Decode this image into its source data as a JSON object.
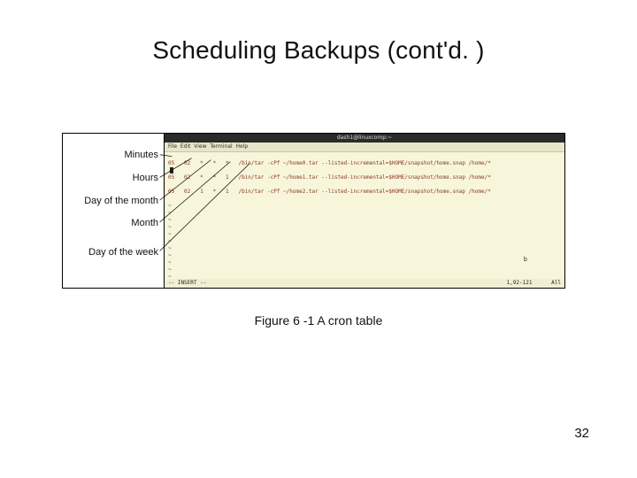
{
  "title": "Scheduling Backups (cont'd. )",
  "caption": "Figure 6 -1 A cron table",
  "page_number": "32",
  "labels": {
    "minutes": "Minutes",
    "hours": "Hours",
    "dom": "Day of the month",
    "month": "Month",
    "dow": "Day of the week"
  },
  "terminal": {
    "window_title": "dash1@linuxcomp:~",
    "menu": "File  Edit  View  Terminal  Help",
    "cron_lines": [
      "05   02   *   *   *   /bin/tar -cPf ~/home0.tar --listed-incremental=$HOME/snapshot/home.snap /home/*",
      "05   02   *   *   1   /bin/tar -cPf ~/home1.tar --listed-incremental=$HOME/snapshot/home.snap /home/*",
      "05   02   1   *   1   /bin/tar -cPf ~/home2.tar --listed-incremental=$HOME/snapshot/home.snap /home/*"
    ],
    "status_left": "-- INSERT --",
    "status_right_pos": "1,92-121",
    "status_right_all": "All",
    "b_marker": "b"
  }
}
